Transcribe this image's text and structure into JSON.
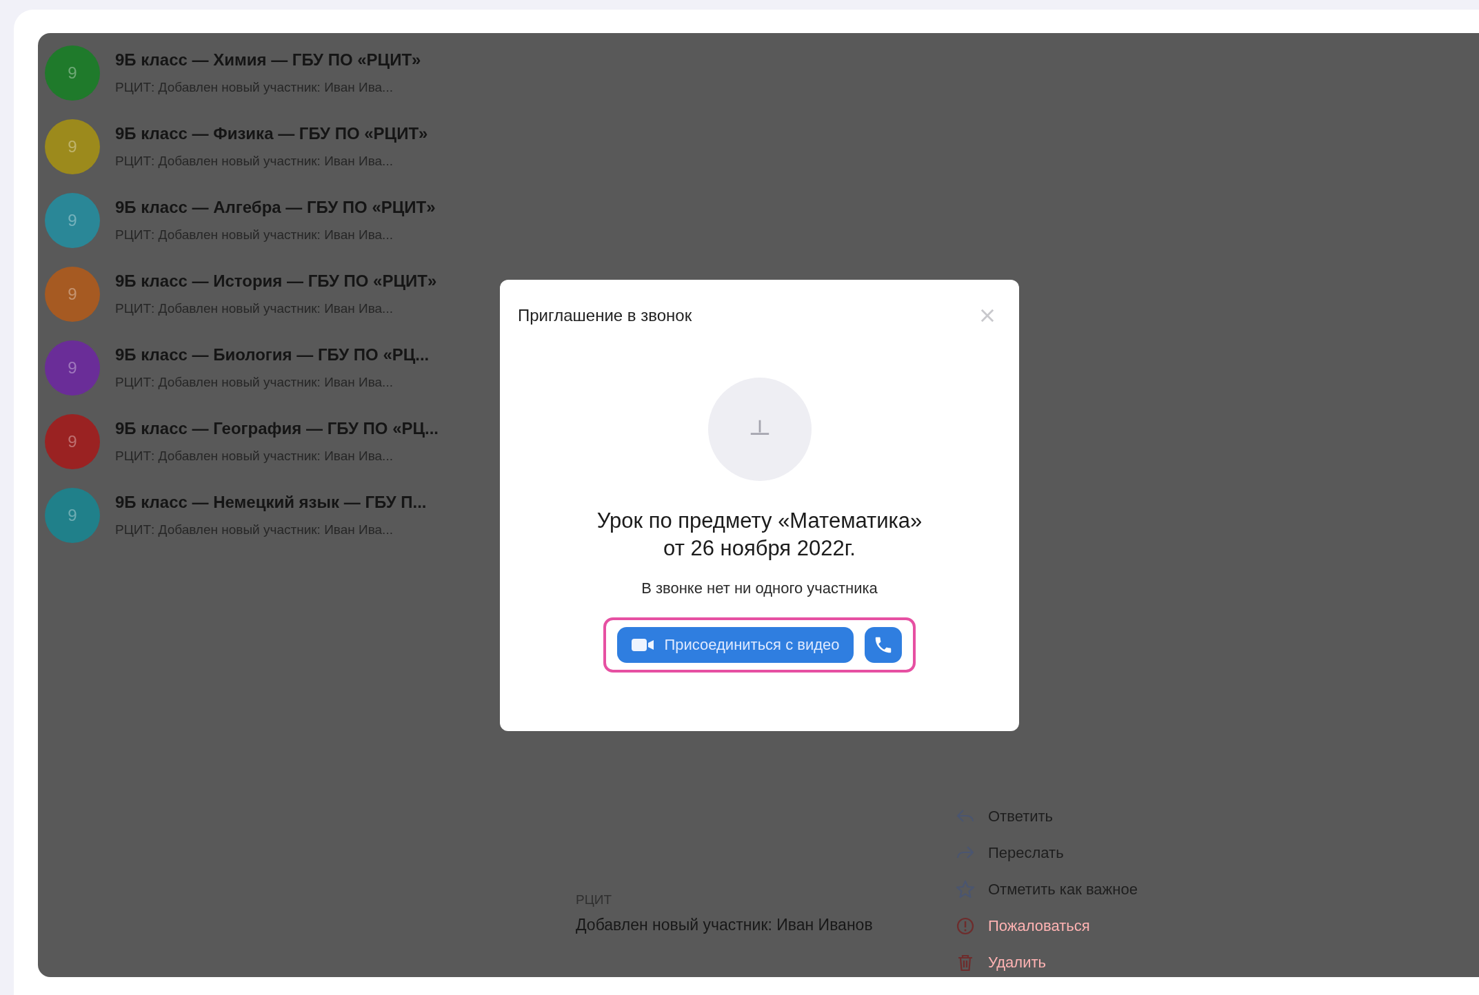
{
  "chats": [
    {
      "avatar": "9",
      "color": "#1f7a2b",
      "name": "9Б класс — Химия — ГБУ ПО «РЦИТ»",
      "preview": "РЦИТ: Добавлен новый участник: Иван Ива..."
    },
    {
      "avatar": "9",
      "color": "#9c8a1c",
      "name": "9Б класс — Физика — ГБУ ПО «РЦИТ»",
      "preview": "РЦИТ: Добавлен новый участник: Иван Ива..."
    },
    {
      "avatar": "9",
      "color": "#2a8797",
      "name": "9Б класс — Алгебра — ГБУ ПО «РЦИТ»",
      "preview": "РЦИТ: Добавлен новый участник: Иван Ива..."
    },
    {
      "avatar": "9",
      "color": "#a65a22",
      "name": "9Б класс — История — ГБУ ПО «РЦИТ»",
      "preview": "РЦИТ: Добавлен новый участник: Иван Ива..."
    },
    {
      "avatar": "9",
      "color": "#6a2d98",
      "name": "9Б класс — Биология — ГБУ ПО «РЦ...",
      "preview": "РЦИТ: Добавлен новый участник: Иван Ива..."
    },
    {
      "avatar": "9",
      "color": "#9a2222",
      "name": "9Б класс — География — ГБУ ПО «РЦ...",
      "preview": "РЦИТ: Добавлен новый участник: Иван Ива..."
    },
    {
      "avatar": "9",
      "color": "#20808a",
      "name": "9Б класс — Немецкий язык — ГБУ П...",
      "preview": "РЦИТ: Добавлен новый участник: Иван Ива..."
    }
  ],
  "message": {
    "sender": "РЦИТ",
    "text": "Добавлен новый участник: Иван Иванов"
  },
  "context_menu": [
    {
      "kind": "reply",
      "label": "Ответить",
      "danger": false
    },
    {
      "kind": "forward",
      "label": "Переслать",
      "danger": false
    },
    {
      "kind": "star",
      "label": "Отметить как важное",
      "danger": false
    },
    {
      "kind": "report",
      "label": "Пожаловаться",
      "danger": true
    },
    {
      "kind": "delete",
      "label": "Удалить",
      "danger": true
    }
  ],
  "dialog": {
    "title": "Приглашение в звонок",
    "heading_line1": "Урок по предмету «Математика»",
    "heading_line2": "от 26 ноября 2022г.",
    "subtitle": "В звонке нет ни одного участника",
    "video_button": "Присоединиться с видео",
    "highlighted": true
  }
}
